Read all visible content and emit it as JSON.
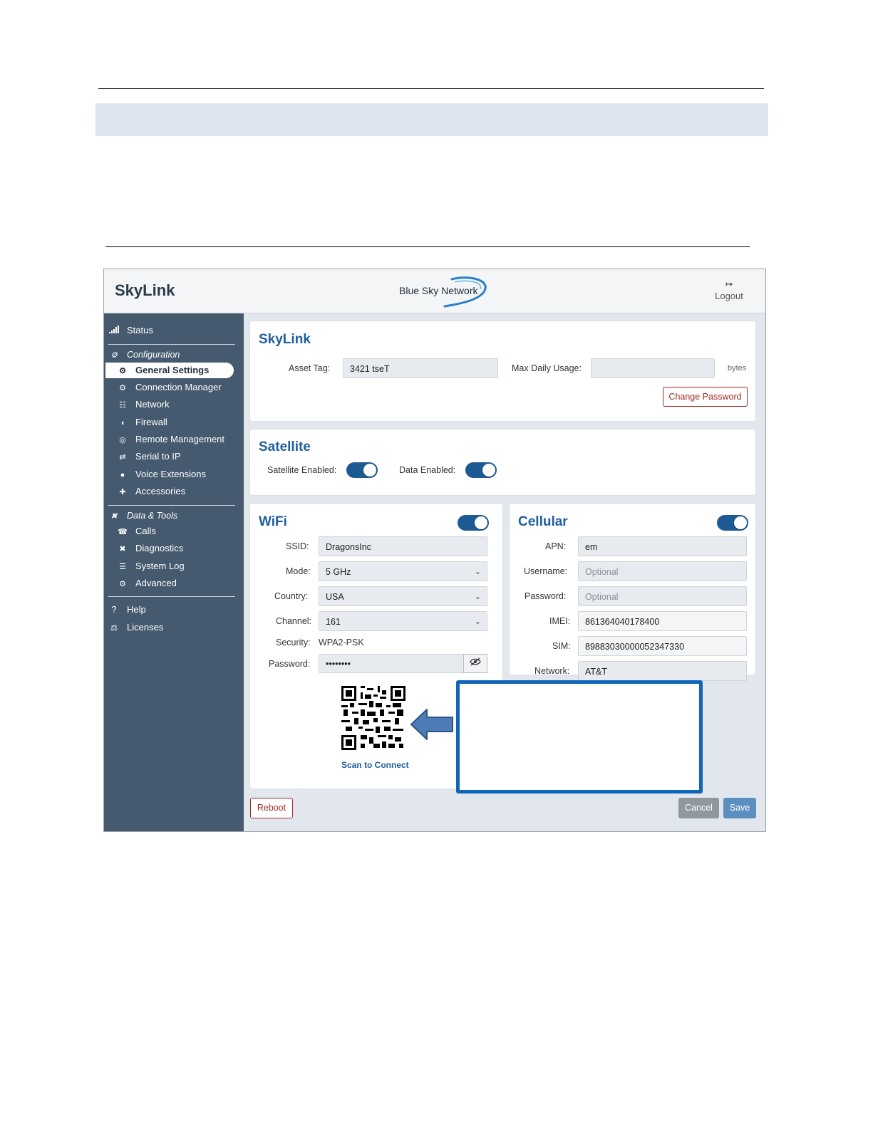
{
  "app": {
    "brand": "SkyLink",
    "network_logo_text": "Blue Sky Network",
    "logout_label": "Logout"
  },
  "sidebar": {
    "status": "Status",
    "configuration": "Configuration",
    "config_items": [
      "General Settings",
      "Connection Manager",
      "Network",
      "Firewall",
      "Remote Management",
      "Serial to IP",
      "Voice Extensions",
      "Accessories"
    ],
    "data_tools": "Data & Tools",
    "tool_items": [
      "Calls",
      "Diagnostics",
      "System Log",
      "Advanced"
    ],
    "help": "Help",
    "licenses": "Licenses",
    "active_item": "General Settings"
  },
  "skylink_card": {
    "title": "SkyLink",
    "asset_tag_label": "Asset Tag:",
    "asset_tag_value": "3421 tseT",
    "max_daily_usage_label": "Max Daily Usage:",
    "max_daily_usage_value": "",
    "bytes_unit": "bytes",
    "change_password": "Change Password"
  },
  "satellite_card": {
    "title": "Satellite",
    "satellite_enabled_label": "Satellite Enabled:",
    "satellite_enabled": true,
    "data_enabled_label": "Data Enabled:",
    "data_enabled": true
  },
  "wifi_card": {
    "title": "WiFi",
    "enabled": true,
    "ssid_label": "SSID:",
    "ssid_value": "DragonsInc",
    "mode_label": "Mode:",
    "mode_value": "5 GHz",
    "country_label": "Country:",
    "country_value": "USA",
    "channel_label": "Channel:",
    "channel_value": "161",
    "security_label": "Security:",
    "security_value": "WPA2-PSK",
    "password_label": "Password:",
    "password_value": "••••••••",
    "qr_caption": "Scan to Connect"
  },
  "cellular_card": {
    "title": "Cellular",
    "enabled": true,
    "apn_label": "APN:",
    "apn_value": "em",
    "username_label": "Username:",
    "username_placeholder": "Optional",
    "password_label": "Password:",
    "password_placeholder": "Optional",
    "imei_label": "IMEI:",
    "imei_value": "861364040178400",
    "sim_label": "SIM:",
    "sim_value": "89883030000052347330",
    "network_label": "Network:",
    "network_value": "AT&T"
  },
  "footer": {
    "reboot": "Reboot",
    "cancel": "Cancel",
    "save": "Save"
  },
  "colors": {
    "sidebar_bg": "#455a6e",
    "title_blue": "#1f5e9c",
    "toggle_blue": "#1d5a93",
    "callout_border": "#0f66b8",
    "reboot_red": "#a12b2b"
  },
  "icons": {
    "status": "signal-bars-icon",
    "configuration": "gears-icon",
    "general_settings": "gear-icon",
    "network": "network-icon",
    "firewall": "shield-icon",
    "remote": "globe-icon",
    "serial": "arrows-icon",
    "voice": "chat-bubble-icon",
    "accessories": "puzzle-icon",
    "tools": "tools-icon",
    "calls": "phone-icon",
    "diagnostics": "wrench-icon",
    "system_log": "list-icon",
    "advanced": "cog-icon",
    "help": "question-icon",
    "licenses": "scale-icon",
    "logout": "logout-icon",
    "eye": "eye-slash-icon",
    "qr": "qr-code-icon",
    "arrow": "left-arrow-icon"
  }
}
